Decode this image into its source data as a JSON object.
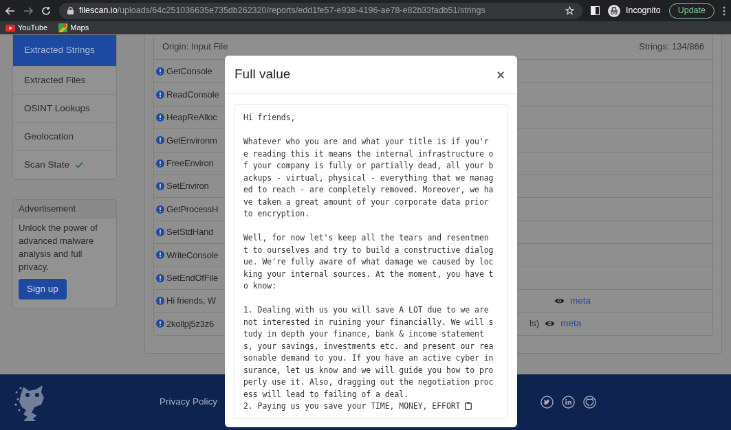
{
  "browser": {
    "url_host": "filescan.io",
    "url_path": "/uploads/64c251036635e735db262320/reports/edd1fe57-e938-4196-ae78-e82b33fadb51/strings",
    "profile_label": "Incognito",
    "update_label": "Update"
  },
  "bookmarks": [
    {
      "label": "YouTube",
      "kind": "youtube"
    },
    {
      "label": "Maps",
      "kind": "maps"
    }
  ],
  "sidebar": {
    "items": [
      {
        "label": "Extracted Strings",
        "selected": true,
        "kind": "plain"
      },
      {
        "label": "Extracted Files",
        "selected": false,
        "kind": "plain"
      },
      {
        "label": "OSINT Lookups",
        "selected": false,
        "kind": "plain"
      },
      {
        "label": "Geolocation",
        "selected": false,
        "kind": "plain"
      },
      {
        "label": "Scan State",
        "selected": false,
        "kind": "done"
      }
    ]
  },
  "advertisement": {
    "title": "Advertisement",
    "text": "Unlock the power of advanced malware analysis and full privacy.",
    "button": "Sign up"
  },
  "strings_panel": {
    "origin_label": "Origin: Input File",
    "count_label": "Strings: 134/866",
    "rows": [
      {
        "text": "GetConsole"
      },
      {
        "text": "ReadConsole"
      },
      {
        "text": "HeapReAlloc"
      },
      {
        "text": "GetEnvironm"
      },
      {
        "text": "FreeEnviron"
      },
      {
        "text": "SetEnviron"
      },
      {
        "text": "GetProcessH"
      },
      {
        "text": "SetStdHand"
      },
      {
        "text": "WriteConsole"
      },
      {
        "text": "SetEndOfFile"
      },
      {
        "text": "Hi friends, W",
        "meta": "meta"
      },
      {
        "text": "2kollpj5z3z6",
        "suffix": "ls)",
        "meta": "meta"
      }
    ]
  },
  "modal": {
    "title": "Full value",
    "close": "×",
    "content": "Hi friends,\n\nWhatever who you are and what your title is if you'r\ne reading this it means the internal infrastructure o\nf your company is fully or partially dead, all your b\nackups - virtual, physical - everything that we manag\ned to reach - are completely removed. Moreover, we ha\nve taken a great amount of your corporate data prior\nto encryption.\n\nWell, for now let's keep all the tears and resentmen\nt to ourselves and try to build a constructive dialog\nue. We're fully aware of what damage we caused by loc\nking your internal sources. At the moment, you have t\no know:\n\n1. Dealing with us you will save A LOT due to we are\nnot interested in ruining your financially. We will s\ntudy in depth your finance, bank & income statement\ns, your savings, investments etc. and present our rea\nsonable demand to you. If you have an active cyber in\nsurance, let us know and we will guide you how to pro\nperly use it. Also, dragging out the negotiation proc\ness will lead to failing of a deal.\n2. Paying us you save your TIME, MONEY, EFFORT"
  },
  "footer": {
    "links": [
      "Privacy Policy"
    ],
    "social": [
      {
        "kind": "twitter"
      },
      {
        "kind": "linkedin"
      },
      {
        "kind": "github"
      }
    ]
  }
}
